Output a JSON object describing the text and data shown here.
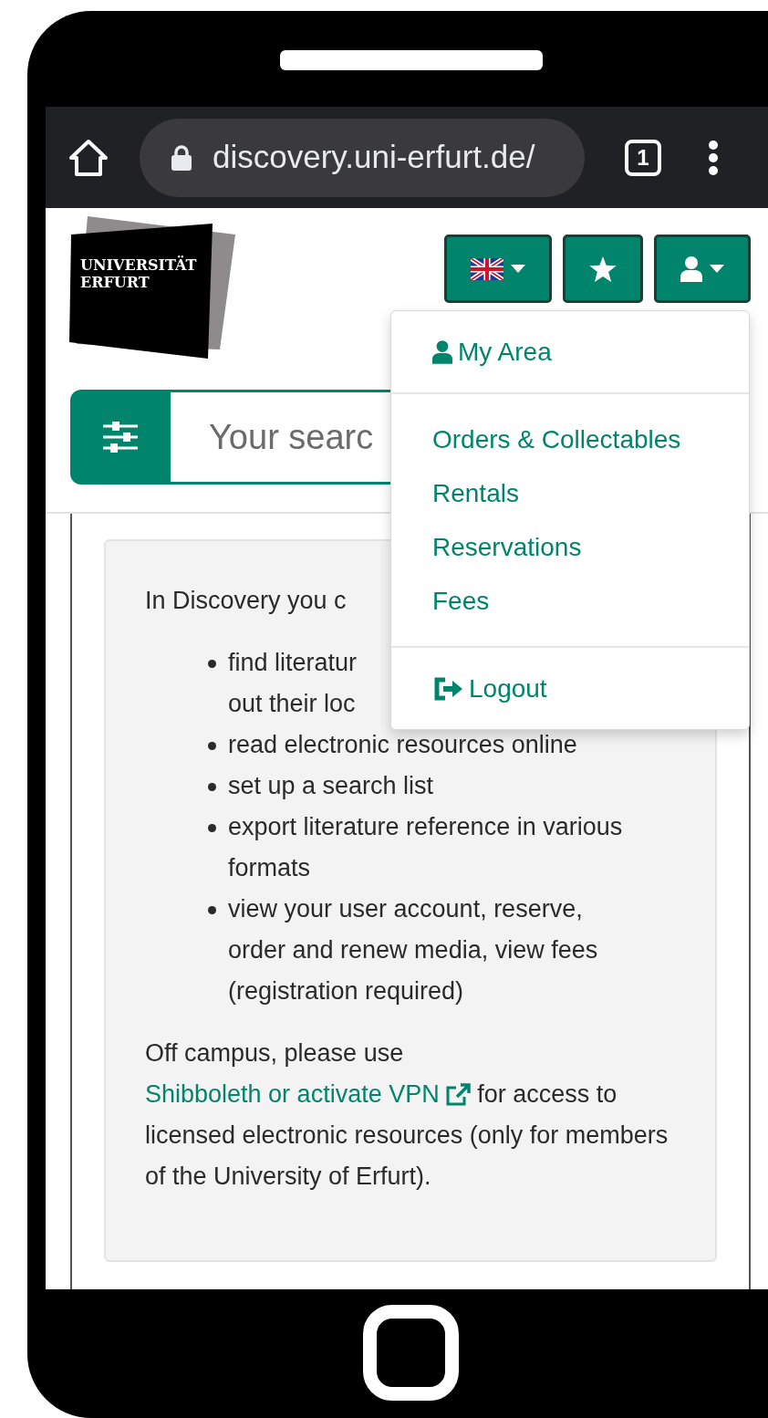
{
  "browser": {
    "url": "discovery.uni-erfurt.de/",
    "tab_count": "1"
  },
  "logo": {
    "lines": [
      "UNIVERSITÄT",
      "ERFURT"
    ]
  },
  "header_buttons": [
    {
      "kind": "language"
    },
    {
      "kind": "favorites"
    },
    {
      "kind": "account"
    }
  ],
  "search": {
    "placeholder": "Your searc"
  },
  "user_menu": {
    "sections": [
      [
        {
          "label": "My Area",
          "kind": "account"
        }
      ],
      [
        {
          "label": "Orders & Collectables",
          "kind": "link"
        },
        {
          "label": "Rentals",
          "kind": "link"
        },
        {
          "label": "Reservations",
          "kind": "link"
        },
        {
          "label": "Fees",
          "kind": "link"
        }
      ],
      [
        {
          "label": "Logout",
          "kind": "logout"
        }
      ]
    ]
  },
  "info_card": {
    "intro": "In Discovery you c",
    "bullets": [
      {
        "lines": [
          "find literatur",
          "out their loc"
        ]
      },
      {
        "text": "read electronic resources online"
      },
      {
        "text": "set up a search list"
      },
      {
        "text": "export literature reference in various formats"
      },
      {
        "text": "view your user account, reserve, order and renew media, view fees (registration required)"
      }
    ],
    "note": {
      "before": "Off campus, please use ",
      "link": "Shibboleth or activate VPN",
      "after": " for access to licensed electronic resources (only for members of the University of Erfurt)."
    }
  }
}
